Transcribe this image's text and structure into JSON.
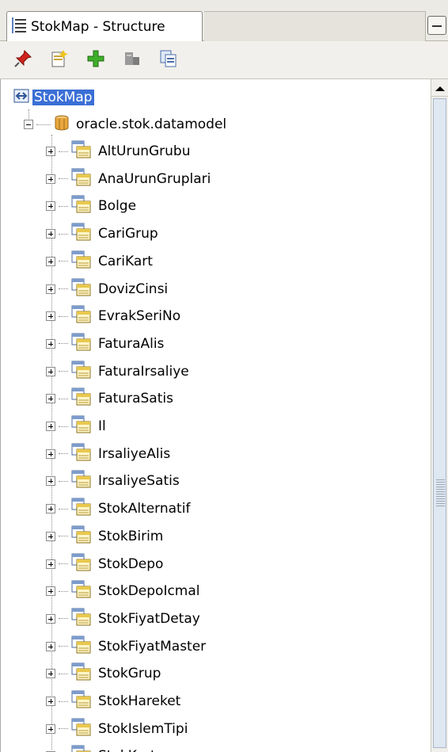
{
  "tab": {
    "title": "StokMap - Structure",
    "icon": "structure-icon"
  },
  "toolbar": {
    "buttons": [
      {
        "name": "pin-button",
        "icon": "pin-icon"
      },
      {
        "name": "new-button",
        "icon": "new-document-icon"
      },
      {
        "name": "add-button",
        "icon": "add-icon"
      },
      {
        "name": "action-button",
        "icon": "gray-tool-icon"
      },
      {
        "name": "copy-button",
        "icon": "copy-icon"
      }
    ]
  },
  "tree": {
    "root": {
      "label": "StokMap",
      "icon": "map-icon"
    },
    "package": {
      "label": "oracle.stok.datamodel",
      "icon": "package-icon"
    },
    "items": [
      "AltUrunGrubu",
      "AnaUrunGruplari",
      "Bolge",
      "CariGrup",
      "CariKart",
      "DovizCinsi",
      "EvrakSeriNo",
      "FaturaAlis",
      "FaturaIrsaliye",
      "FaturaSatis",
      "Il",
      "IrsaliyeAlis",
      "IrsaliyeSatis",
      "StokAlternatif",
      "StokBirim",
      "StokDepo",
      "StokDepoIcmal",
      "StokFiyatDetay",
      "StokFiyatMaster",
      "StokGrup",
      "StokHareket",
      "StokIslemTipi",
      "StokKart"
    ]
  },
  "colors": {
    "selection": "#3b6fd6",
    "background": "#ffffff",
    "toolbar": "#f2f0ec"
  }
}
